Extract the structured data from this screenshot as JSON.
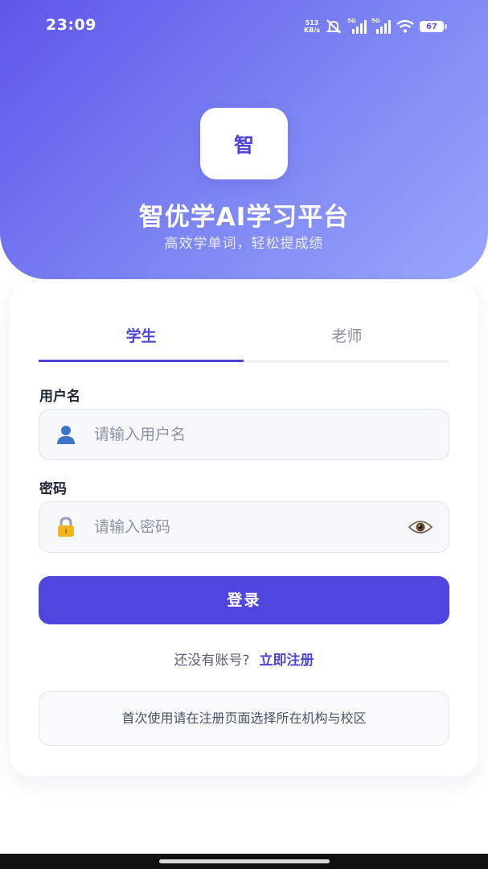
{
  "status_bar": {
    "time": "23:09",
    "net_speed_value": "513",
    "net_speed_unit": "KB/s",
    "signal_1_label": "5G",
    "signal_2_label": "5G",
    "battery": "67"
  },
  "header": {
    "logo_char": "智",
    "title": "智优学AI学习平台",
    "subtitle": "高效学单词，轻松提成绩"
  },
  "tabs": [
    {
      "label": "学生",
      "active": true
    },
    {
      "label": "老师",
      "active": false
    }
  ],
  "form": {
    "username_label": "用户名",
    "username_placeholder": "请输入用户名",
    "username_icon": "user-icon",
    "password_label": "密码",
    "password_placeholder": "请输入密码",
    "password_icon": "lock-icon",
    "toggle_icon": "eye-icon",
    "login_label": "登录"
  },
  "register": {
    "prompt": "还没有账号?",
    "link": "立即注册"
  },
  "notice": "首次使用请在注册页面选择所在机构与校区",
  "colors": {
    "accent": "#5145df",
    "header_start": "#5f55ea",
    "header_end": "#9aa6fb"
  }
}
